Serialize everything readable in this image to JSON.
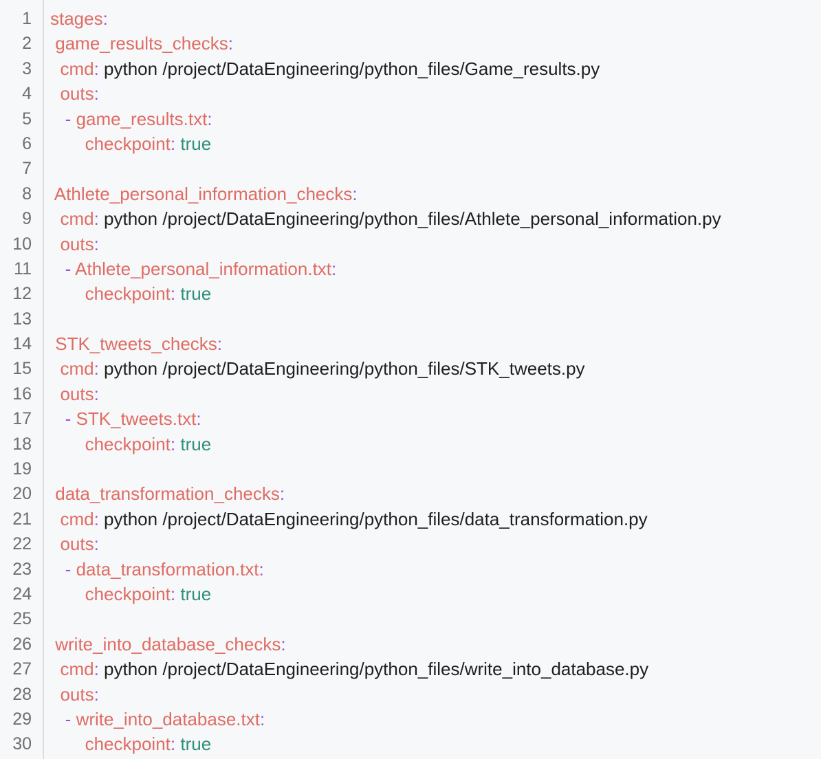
{
  "colors": {
    "background": "#f6f8fa",
    "line_number": "#6f6f6f",
    "key": "#e06c63",
    "punctuation": "#9b51e0",
    "text": "#1f1f1f",
    "boolean": "#2f8f7a"
  },
  "lines": [
    {
      "num": "1",
      "indent": "",
      "dash": "",
      "key": "stages",
      "colon": ":",
      "value": "",
      "value_type": ""
    },
    {
      "num": "2",
      "indent": " ",
      "dash": "",
      "key": "game_results_checks",
      "colon": ":",
      "value": "",
      "value_type": ""
    },
    {
      "num": "3",
      "indent": "  ",
      "dash": "",
      "key": "cmd",
      "colon": ":",
      "value": " python /project/DataEngineering/python_files/Game_results.py",
      "value_type": "text"
    },
    {
      "num": "4",
      "indent": "  ",
      "dash": "",
      "key": "outs",
      "colon": ":",
      "value": "",
      "value_type": ""
    },
    {
      "num": "5",
      "indent": "   ",
      "dash": "- ",
      "key": "game_results.txt",
      "colon": ":",
      "value": "",
      "value_type": ""
    },
    {
      "num": "6",
      "indent": "       ",
      "dash": "",
      "key": "checkpoint",
      "colon": ":",
      "value": " true",
      "value_type": "bool"
    },
    {
      "num": "7",
      "indent": "",
      "dash": "",
      "key": "",
      "colon": "",
      "value": "",
      "value_type": ""
    },
    {
      "num": "8",
      "indent": " ",
      "dash": "",
      "key": "Athlete_personal_information_checks",
      "colon": ":",
      "value": "",
      "value_type": ""
    },
    {
      "num": "9",
      "indent": "  ",
      "dash": "",
      "key": "cmd",
      "colon": ":",
      "value": " python /project/DataEngineering/python_files/Athlete_personal_information.py",
      "value_type": "text"
    },
    {
      "num": "10",
      "indent": "  ",
      "dash": "",
      "key": "outs",
      "colon": ":",
      "value": "",
      "value_type": ""
    },
    {
      "num": "11",
      "indent": "   ",
      "dash": "- ",
      "key": "Athlete_personal_information.txt",
      "colon": ":",
      "value": "",
      "value_type": ""
    },
    {
      "num": "12",
      "indent": "       ",
      "dash": "",
      "key": "checkpoint",
      "colon": ":",
      "value": " true",
      "value_type": "bool"
    },
    {
      "num": "13",
      "indent": "",
      "dash": "",
      "key": "",
      "colon": "",
      "value": "",
      "value_type": ""
    },
    {
      "num": "14",
      "indent": " ",
      "dash": "",
      "key": "STK_tweets_checks",
      "colon": ":",
      "value": "",
      "value_type": ""
    },
    {
      "num": "15",
      "indent": "  ",
      "dash": "",
      "key": "cmd",
      "colon": ":",
      "value": " python /project/DataEngineering/python_files/STK_tweets.py",
      "value_type": "text"
    },
    {
      "num": "16",
      "indent": "  ",
      "dash": "",
      "key": "outs",
      "colon": ":",
      "value": "",
      "value_type": ""
    },
    {
      "num": "17",
      "indent": "   ",
      "dash": "- ",
      "key": "STK_tweets.txt",
      "colon": ":",
      "value": "",
      "value_type": ""
    },
    {
      "num": "18",
      "indent": "       ",
      "dash": "",
      "key": "checkpoint",
      "colon": ":",
      "value": " true",
      "value_type": "bool"
    },
    {
      "num": "19",
      "indent": "",
      "dash": "",
      "key": "",
      "colon": "",
      "value": "",
      "value_type": ""
    },
    {
      "num": "20",
      "indent": " ",
      "dash": "",
      "key": "data_transformation_checks",
      "colon": ":",
      "value": "",
      "value_type": ""
    },
    {
      "num": "21",
      "indent": "  ",
      "dash": "",
      "key": "cmd",
      "colon": ":",
      "value": " python /project/DataEngineering/python_files/data_transformation.py",
      "value_type": "text"
    },
    {
      "num": "22",
      "indent": "  ",
      "dash": "",
      "key": "outs",
      "colon": ":",
      "value": "",
      "value_type": ""
    },
    {
      "num": "23",
      "indent": "   ",
      "dash": "- ",
      "key": "data_transformation.txt",
      "colon": ":",
      "value": "",
      "value_type": ""
    },
    {
      "num": "24",
      "indent": "       ",
      "dash": "",
      "key": "checkpoint",
      "colon": ":",
      "value": " true",
      "value_type": "bool"
    },
    {
      "num": "25",
      "indent": "",
      "dash": "",
      "key": "",
      "colon": "",
      "value": "",
      "value_type": ""
    },
    {
      "num": "26",
      "indent": " ",
      "dash": "",
      "key": "write_into_database_checks",
      "colon": ":",
      "value": "",
      "value_type": ""
    },
    {
      "num": "27",
      "indent": "  ",
      "dash": "",
      "key": "cmd",
      "colon": ":",
      "value": " python /project/DataEngineering/python_files/write_into_database.py",
      "value_type": "text"
    },
    {
      "num": "28",
      "indent": "  ",
      "dash": "",
      "key": "outs",
      "colon": ":",
      "value": "",
      "value_type": ""
    },
    {
      "num": "29",
      "indent": "   ",
      "dash": "- ",
      "key": "write_into_database.txt",
      "colon": ":",
      "value": "",
      "value_type": ""
    },
    {
      "num": "30",
      "indent": "       ",
      "dash": "",
      "key": "checkpoint",
      "colon": ":",
      "value": " true",
      "value_type": "bool"
    }
  ]
}
